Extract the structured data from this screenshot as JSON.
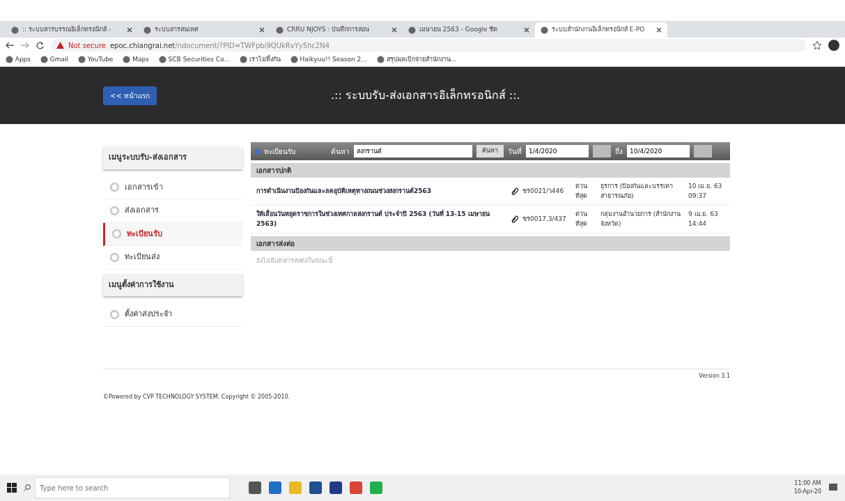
{
  "browser": {
    "tabs": [
      {
        "title": ":: ระบบสารบรรณอิเล็กทรอนิกส์ -",
        "selected": false
      },
      {
        "title": "ระบบสารสนเทศ",
        "selected": false
      },
      {
        "title": "CRRU NJOYS : บันทึกการสอน",
        "selected": false
      },
      {
        "title": "เมษายน 2563 - Google ชีต",
        "selected": false
      },
      {
        "title": "ระบบสำนักงานอิเล็กทรอนิกส์ E-PO",
        "selected": true
      }
    ],
    "security": "Not secure",
    "url_host": "epoc.chiangrai.net",
    "url_path": "/ndocument/?PID=TWFpbi9QUkRvYy5hc2N4",
    "bookmarks": [
      "Apps",
      "Gmail",
      "YouTube",
      "Maps",
      "SCB Securities Co...",
      "เราไม่ทิ้งกัน",
      "Haikyuu!! Season 2...",
      "สรุปผลเบิกจ่ายสำนักงาน..."
    ]
  },
  "header": {
    "home_button": "<< หน้าแรก",
    "title": ".:: ระบบรับ-ส่งเอกสารอิเล็กทรอนิกส์ ::."
  },
  "sidebar": [
    {
      "heading": "เมนูระบบรับ-ส่งเอกสาร",
      "items": [
        {
          "label": "เอกสารเข้า",
          "selected": false
        },
        {
          "label": "ส่งเอกสาร",
          "selected": false
        },
        {
          "label": "ทะเบียนรับ",
          "selected": true
        },
        {
          "label": "ทะเบียนส่ง",
          "selected": false
        }
      ]
    },
    {
      "heading": "เมนูตั้งค่าการใช้งาน",
      "items": [
        {
          "label": "ตั้งค่าส่งประจำ",
          "selected": false
        }
      ]
    }
  ],
  "toolbar": {
    "title": "ทะเบียนรับ",
    "search_label": "ค้นหา",
    "search_value": "สงกรานต์",
    "search_button": "ค้นหา",
    "date_label": "วันที่",
    "date_from": "1/4/2020",
    "to_label": "ถึง",
    "date_to": "10/4/2020"
  },
  "sections": [
    {
      "heading": "เอกสารปกติ",
      "rows": [
        {
          "subject": "การดำเนินงานป้องกันและลดอุบัติเหตุทางถนนช่วงสงกรานต์2563",
          "number": "ชร0021/ว446",
          "urgency": "ด่วนที่สุด",
          "from": "ธุรการ (ป้องกันและบรรเทาสาธารณภัย)",
          "date": "10 เม.ย. 63 09:37"
        },
        {
          "subject": "ให้เลื่อนวันหยุดราชการในช่วงเทศกาลสงกรานต์ ประจำปี 2563 (วันที่ 13-15 เมษายน 2563)",
          "number": "ชร0017.3/437",
          "urgency": "ด่วนที่สุด",
          "from": "กลุ่มงานอำนวยการ (สำนักงานจังหวัด)",
          "date": "9 เม.ย. 63 14:44"
        }
      ]
    },
    {
      "heading": "เอกสารส่งต่อ",
      "empty": "ยังไม่มีเอกสารส่งต่อในขณะนี้"
    }
  ],
  "version": "Version 3.1",
  "footer": "©Powered by CVP TECHNOLOGY SYSTEM. Copyright © 2005-2010.",
  "taskbar": {
    "search_placeholder": "Type here to search",
    "time": "11:00 AM",
    "date": "10-Apr-20"
  }
}
